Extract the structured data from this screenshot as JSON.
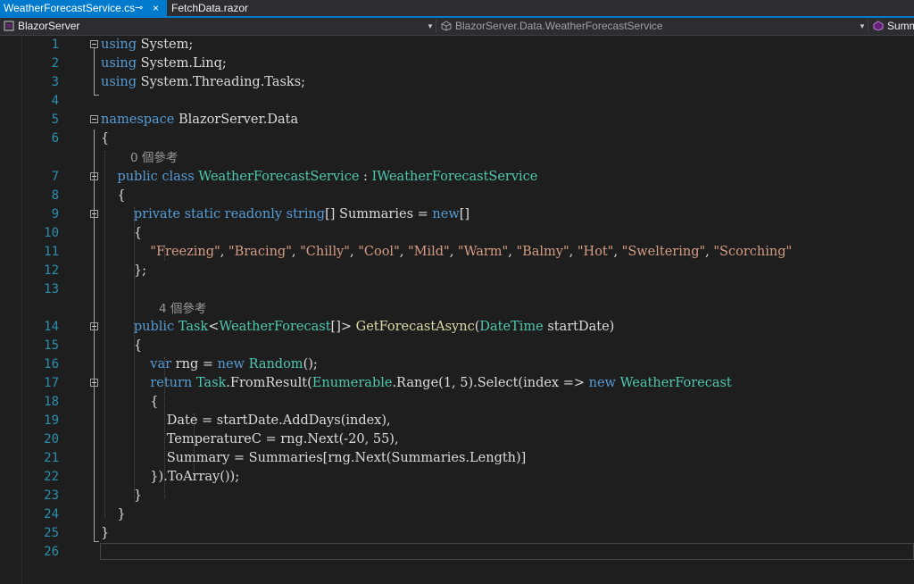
{
  "tabs": [
    {
      "label": "WeatherForecastService.cs",
      "active": true
    },
    {
      "label": "FetchData.razor",
      "active": false
    }
  ],
  "tab_glyphs": {
    "pin": "⊸",
    "close": "×"
  },
  "navbar": {
    "project": "BlazorServer",
    "type": "BlazorServer.Data.WeatherForecastService",
    "member": "Summ"
  },
  "icons": {
    "project": "csharp-project-icon",
    "type": "class-icon",
    "member": "method-icon"
  },
  "colors": {
    "keyword": "#569cd6",
    "type": "#4ec9b0",
    "string": "#d69d85",
    "line_number": "#2b91af",
    "tab_active": "#007acc"
  },
  "lens": {
    "l7": "0 個參考",
    "l14": "4 個參考"
  },
  "lines": [
    {
      "n": "1",
      "t0": "using",
      "t1": " System;"
    },
    {
      "n": "2",
      "t0": "using",
      "t1": " System.Linq;"
    },
    {
      "n": "3",
      "t0": "using",
      "t1": " System.Threading.Tasks;"
    },
    {
      "n": "4"
    },
    {
      "n": "5",
      "t0": "namespace",
      "t1": " BlazorServer.Data"
    },
    {
      "n": "6",
      "t0": "{"
    },
    {
      "n": "7",
      "t0": "    public class ",
      "t1": "WeatherForecastService",
      "t2": " : ",
      "t3": "IWeatherForecastService"
    },
    {
      "n": "8",
      "t0": "    {"
    },
    {
      "n": "9",
      "t0": "        private static readonly string",
      "t1": "[] Summaries = ",
      "t2": "new",
      "t3": "[]"
    },
    {
      "n": "10",
      "t0": "        {"
    },
    {
      "n": "11",
      "t0": "            \"Freezing\"",
      "t1": ", ",
      "t2": "\"Bracing\"",
      "t3": ", ",
      "t4": "\"Chilly\"",
      "t5": ", ",
      "t6": "\"Cool\"",
      "t7": ", ",
      "t8": "\"Mild\"",
      "t9": ", ",
      "t10": "\"Warm\"",
      "t11": ", ",
      "t12": "\"Balmy\"",
      "t13": ", ",
      "t14": "\"Hot\"",
      "t15": ", ",
      "t16": "\"Sweltering\"",
      "t17": ", ",
      "t18": "\"Scorching\""
    },
    {
      "n": "12",
      "t0": "        };"
    },
    {
      "n": "13"
    },
    {
      "n": "14",
      "t0": "        public ",
      "t1": "Task",
      "t2": "<",
      "t3": "WeatherForecast",
      "t4": "[]> ",
      "t5": "GetForecastAsync",
      "t6": "(",
      "t7": "DateTime",
      "t8": " startDate)"
    },
    {
      "n": "15",
      "t0": "        {"
    },
    {
      "n": "16",
      "t0": "            var",
      "t1": " rng = ",
      "t2": "new ",
      "t3": "Random",
      "t4": "();"
    },
    {
      "n": "17",
      "t0": "            return ",
      "t1": "Task",
      "t2": ".FromResult(",
      "t3": "Enumerable",
      "t4": ".Range(1, 5).Select(index => ",
      "t5": "new ",
      "t6": "WeatherForecast"
    },
    {
      "n": "18",
      "t0": "            {"
    },
    {
      "n": "19",
      "t0": "                Date = startDate.AddDays(index),"
    },
    {
      "n": "20",
      "t0": "                TemperatureC = rng.Next(-20, 55),"
    },
    {
      "n": "21",
      "t0": "                Summary = Summaries[rng.Next(Summaries.Length)]"
    },
    {
      "n": "22",
      "t0": "            }).ToArray());"
    },
    {
      "n": "23",
      "t0": "        }"
    },
    {
      "n": "24",
      "t0": "    }"
    },
    {
      "n": "25",
      "t0": "}"
    },
    {
      "n": "26"
    }
  ]
}
